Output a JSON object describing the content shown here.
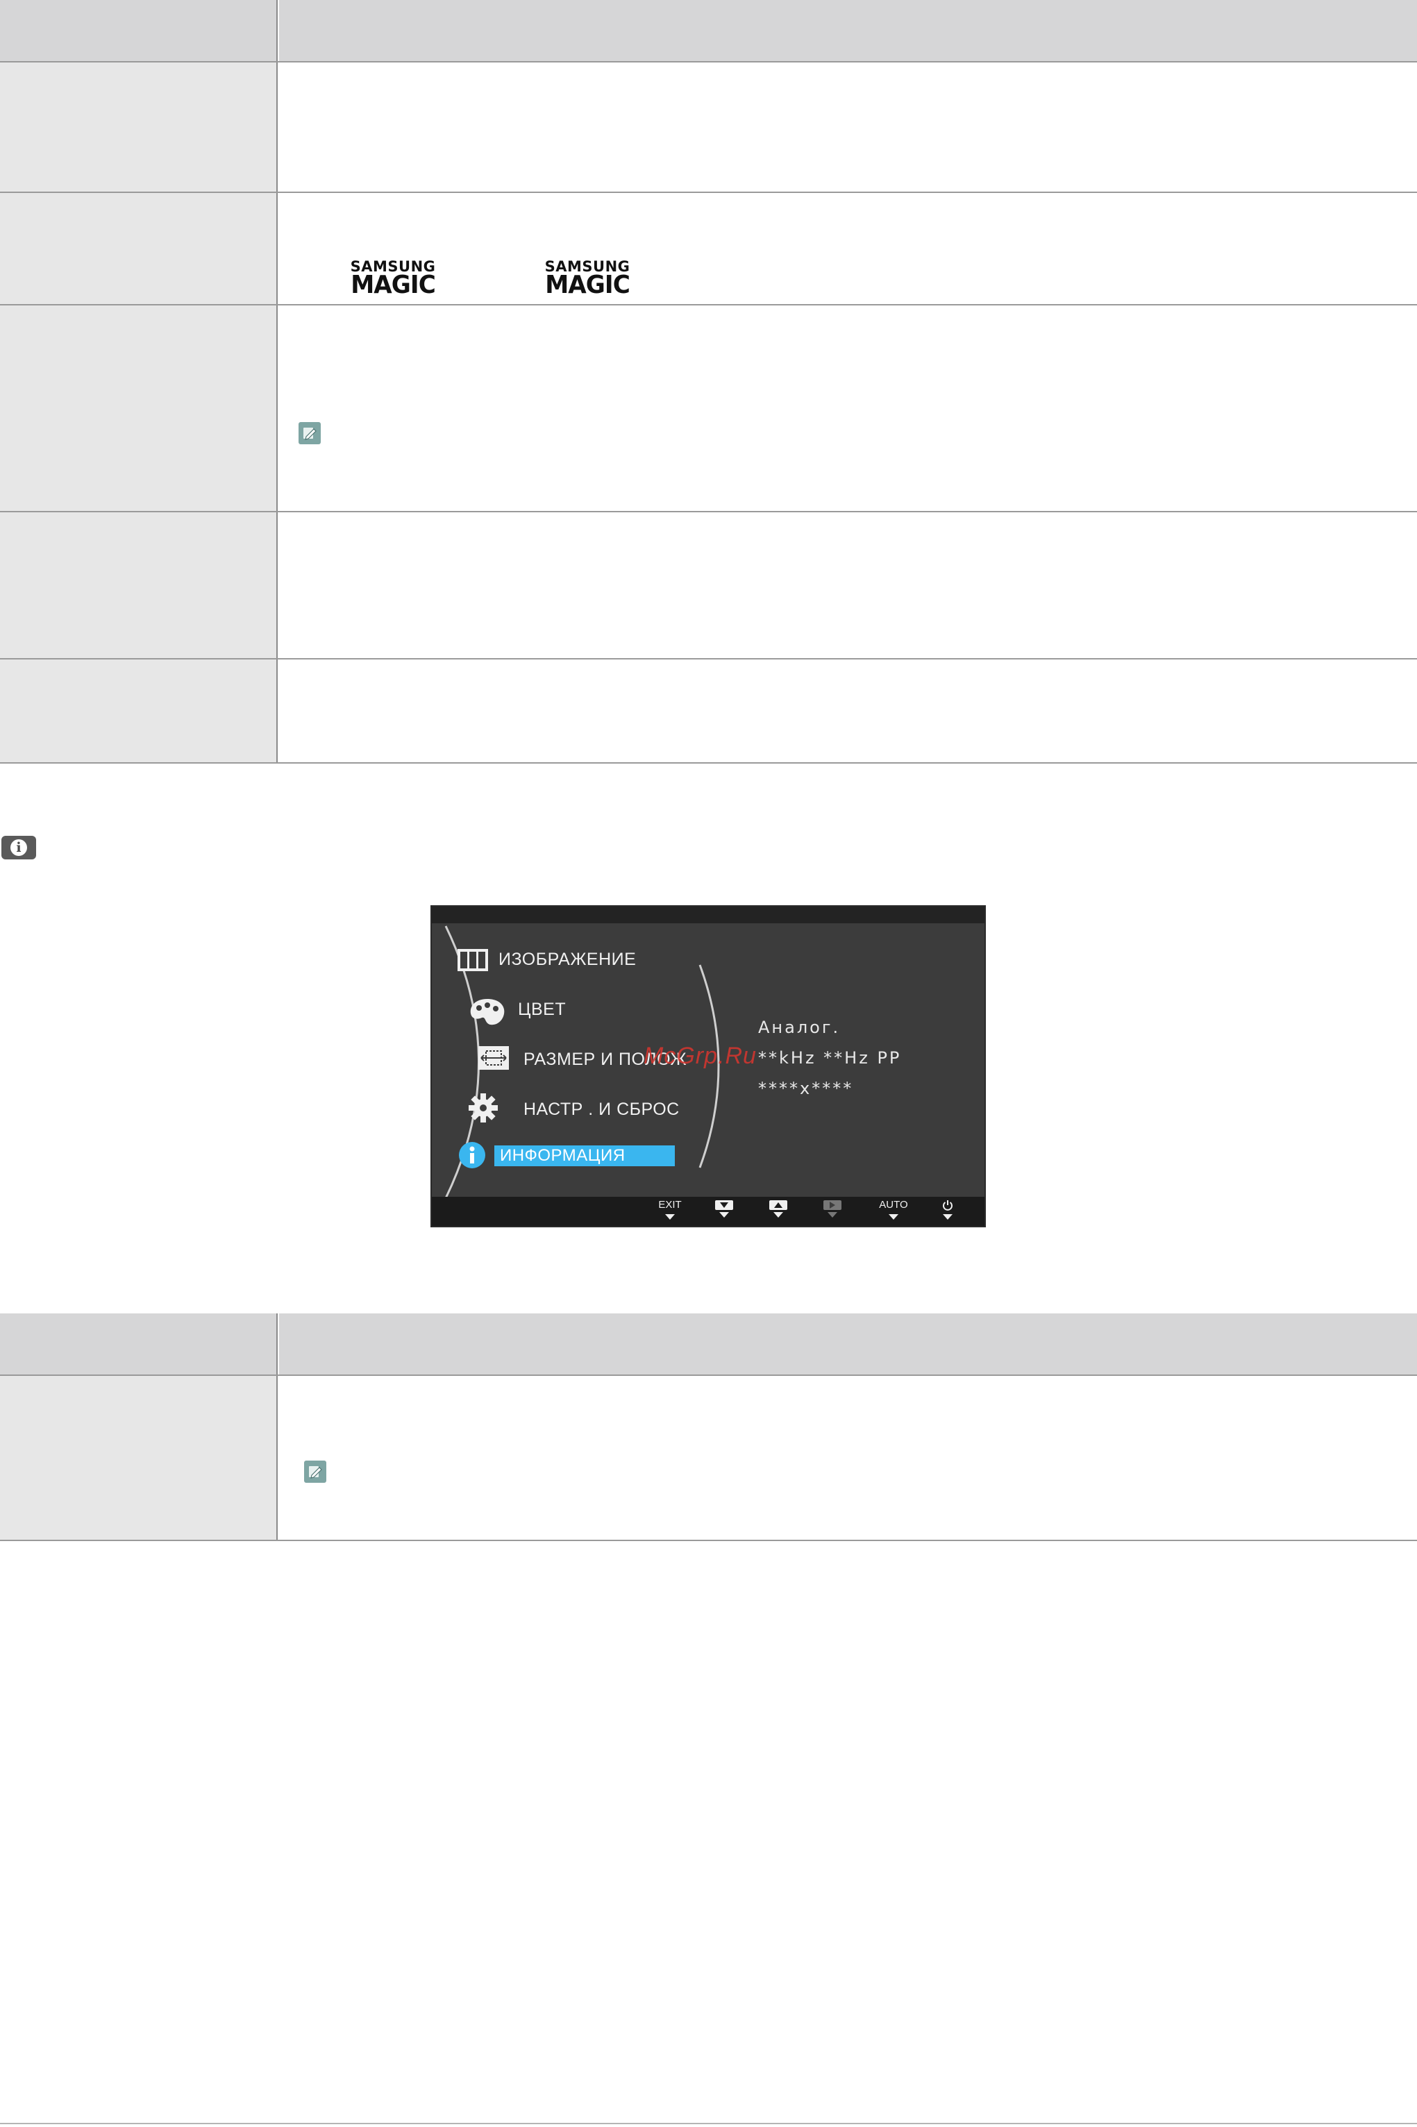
{
  "logos": {
    "left": {
      "line1": "SAMSUNG",
      "line2": "MAGIC"
    },
    "right": {
      "line1": "SAMSUNG",
      "line2": "MAGIC"
    }
  },
  "osd": {
    "menu": [
      {
        "label": "ИЗОБРАЖЕНИЕ",
        "icon": "picture-icon"
      },
      {
        "label": "ЦВЕТ",
        "icon": "palette-icon"
      },
      {
        "label": "РАЗМЕР  И  ПОЛОЖ",
        "icon": "size-position-icon"
      },
      {
        "label": "НАСТР .  И  СБРОС",
        "icon": "gear-icon"
      },
      {
        "label": "ИНФОРМАЦИЯ",
        "icon": "info-icon",
        "selected": true
      }
    ],
    "info_lines": [
      "Аналог.",
      "**kHz **Hz PP",
      "****x****"
    ],
    "watermark": "McGrp.Ru",
    "buttons": [
      {
        "label": "EXIT"
      },
      {
        "label": "",
        "key": "down"
      },
      {
        "label": "",
        "key": "up"
      },
      {
        "label": "",
        "key": "right",
        "dim": true
      },
      {
        "label": "AUTO"
      },
      {
        "label": "",
        "key": "power"
      }
    ],
    "colors": {
      "background": "#3c3c3c",
      "selection": "#3ab6ef",
      "watermark": "#d9352f"
    }
  }
}
